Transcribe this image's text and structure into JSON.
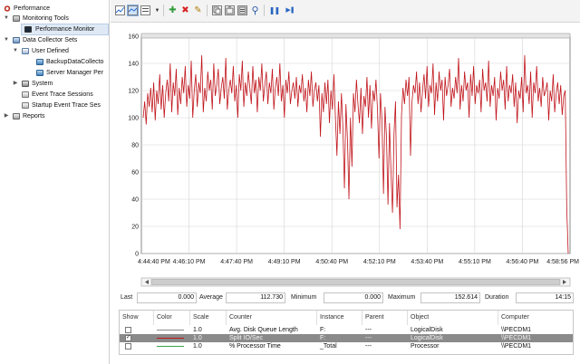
{
  "tree": {
    "root": "Performance",
    "monitoring_tools": "Monitoring Tools",
    "performance_monitor": "Performance Monitor",
    "data_collector_sets": "Data Collector Sets",
    "user_defined": "User Defined",
    "backup_collector": "BackupDataCollecto",
    "server_manager": "Server Manager Per",
    "system": "System",
    "event_trace_sessions": "Event Trace Sessions",
    "startup_event_trace": "Startup Event Trace Ses",
    "reports": "Reports"
  },
  "toolbar": {
    "icons": [
      "view-graph-icon",
      "change-graph-type-icon",
      "dropdown-arrow-icon",
      "add-counter-icon",
      "delete-counter-icon",
      "highlight-icon",
      "copy-properties-icon",
      "paste-list-icon",
      "properties-icon",
      "zoom-icon",
      "freeze-display-icon",
      "update-data-icon"
    ],
    "add_symbol": "✚",
    "delete_symbol": "✖",
    "highlight_symbol": "✎",
    "zoom_symbol": "⚲",
    "pause_symbol": "❚❚",
    "next_symbol": "▶❚"
  },
  "chart_data": {
    "type": "line",
    "ylim": [
      0,
      160
    ],
    "yticks": [
      "0",
      "20",
      "40",
      "60",
      "80",
      "100",
      "120",
      "140",
      "160"
    ],
    "xticks": [
      "4:44:40 PM",
      "4:46:10 PM",
      "4:47:40 PM",
      "4:49:10 PM",
      "4:50:40 PM",
      "4:52:10 PM",
      "4:53:40 PM",
      "4:55:10 PM",
      "4:56:40 PM",
      "4:58:56 PM"
    ],
    "grid": true,
    "series": [
      {
        "color": "#c0141b",
        "values": [
          100,
          112,
          95,
          118,
          108,
          122,
          104,
          126,
          98,
          120,
          110,
          132,
          106,
          124,
          100,
          118,
          128,
          112,
          140,
          104,
          126,
          116,
          136,
          102,
          122,
          110,
          130,
          118,
          138,
          108,
          124,
          114,
          142,
          100,
          120,
          132,
          108,
          126,
          118,
          146,
          104,
          122,
          112,
          134,
          120,
          128,
          106,
          140,
          116,
          124,
          136,
          110,
          122,
          130,
          114,
          144,
          106,
          120,
          128,
          118,
          138,
          112,
          124,
          100,
          132,
          120,
          142,
          108,
          126,
          116,
          134,
          122,
          110,
          138,
          118,
          128,
          104,
          130,
          120,
          140,
          112,
          124,
          134,
          110,
          126,
          118,
          136,
          106,
          122,
          130,
          116,
          140,
          112,
          124,
          100,
          128,
          118,
          134,
          110,
          120,
          126,
          114,
          130,
          108,
          124,
          118,
          132,
          112,
          122,
          104,
          128,
          116,
          134,
          108,
          120,
          126,
          112,
          124,
          86,
          118,
          104,
          126,
          110,
          128,
          96,
          120,
          106,
          132,
          100,
          72,
          112,
          88,
          118,
          92,
          48,
          110,
          84,
          40,
          100,
          64,
          118,
          104,
          128,
          110,
          96,
          122,
          88,
          116,
          108,
          130,
          100,
          124,
          92,
          120,
          112,
          128,
          106,
          70,
          118,
          98,
          44,
          108,
          86,
          36,
          96,
          60,
          30,
          88,
          112,
          34,
          58,
          18,
          102,
          122,
          110,
          128,
          116,
          130,
          72,
          112,
          124,
          118,
          134,
          110,
          126,
          104,
          120,
          132,
          114,
          138,
          108,
          124,
          118,
          140,
          102,
          126,
          112,
          134,
          120,
          128,
          98,
          130,
          116,
          124,
          136,
          108,
          122,
          114,
          130,
          118,
          144,
          106,
          124,
          112,
          134,
          120,
          126,
          100,
          132,
          116,
          138,
          110,
          124,
          118,
          128,
          104,
          136,
          120,
          126,
          112,
          142,
          108,
          124,
          116,
          130,
          98,
          122,
          114,
          134,
          120,
          128,
          106,
          138,
          112,
          124,
          118,
          132,
          108,
          126,
          96,
          120,
          114,
          130,
          104,
          146,
          118,
          124,
          110,
          134,
          100,
          126,
          118,
          138,
          112,
          122,
          108,
          130,
          116,
          120,
          126,
          98,
          120,
          112,
          132,
          104,
          118,
          126,
          110,
          124,
          102,
          116,
          120,
          34,
          0
        ]
      }
    ]
  },
  "stats": {
    "last_label": "Last",
    "last_value": "0.000",
    "average_label": "Average",
    "average_value": "112.730",
    "minimum_label": "Minimum",
    "minimum_value": "0.000",
    "maximum_label": "Maximum",
    "maximum_value": "152.614",
    "duration_label": "Duration",
    "duration_value": "14:15"
  },
  "table": {
    "headers": [
      "Show",
      "Color",
      "Scale",
      "Counter",
      "Instance",
      "Parent",
      "Object",
      "Computer"
    ],
    "rows": [
      {
        "checked": false,
        "check_mark": "",
        "color": "#8a8a8a",
        "scale": "1.0",
        "counter": "Avg. Disk Queue Length",
        "instance": "F:",
        "parent": "---",
        "object": "LogicalDisk",
        "computer": "\\\\PECDM1"
      },
      {
        "checked": true,
        "check_mark": "✓",
        "color": "#c0141b",
        "scale": "1.0",
        "counter": "Split IO/Sec",
        "instance": "F:",
        "parent": "---",
        "object": "LogicalDisk",
        "computer": "\\\\PECDM1"
      },
      {
        "checked": false,
        "check_mark": "",
        "color": "#3aa24a",
        "scale": "1.0",
        "counter": "% Processor Time",
        "instance": "_Total",
        "parent": "---",
        "object": "Processor",
        "computer": "\\\\PECDM1"
      }
    ]
  }
}
